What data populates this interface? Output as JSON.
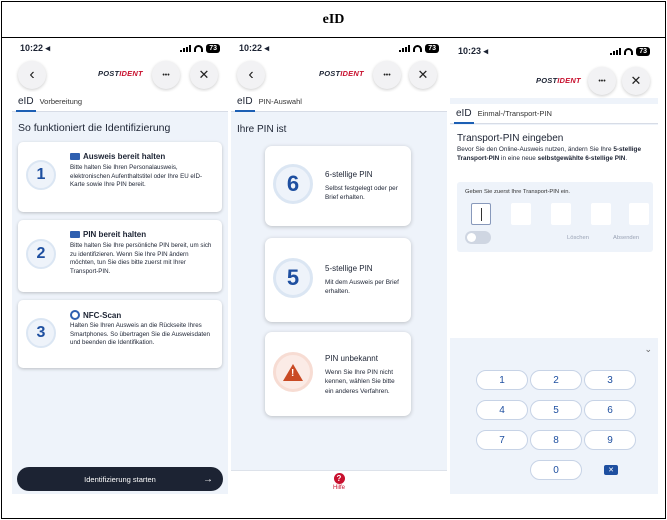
{
  "header": {
    "title": "eID"
  },
  "common": {
    "brand_post": "POST",
    "brand_ident": "IDENT",
    "back_glyph": "‹",
    "more_glyph": "•••",
    "close_glyph": "✕",
    "battery": "73"
  },
  "panel1": {
    "time": "10:22 ◂",
    "tab": "eID",
    "step": "Vorbereitung",
    "title": "So funktioniert die Identifizierung",
    "steps": [
      {
        "num": "1",
        "icon": "id-card-icon",
        "heading": "Ausweis bereit halten",
        "text": "Bitte halten Sie Ihren Personalausweis, elektronischen Aufenthaltstitel oder Ihre EU eID-Karte sowie Ihre PIN bereit."
      },
      {
        "num": "2",
        "icon": "keyboard-icon",
        "heading": "PIN bereit halten",
        "text": "Bitte halten Sie Ihre persönliche PIN bereit, um sich zu identifizieren. Wenn Sie Ihre PIN ändern möchten, tun Sie dies bitte zuerst mit Ihrer Transport-PIN."
      },
      {
        "num": "3",
        "icon": "nfc-icon",
        "heading": "NFC-Scan",
        "text": "Halten Sie Ihren Ausweis an die Rückseite Ihres Smartphones. So übertragen Sie die Ausweisdaten und beenden die Identifikation."
      }
    ],
    "start_button": "Identifizierung starten",
    "start_arrow": "→"
  },
  "panel2": {
    "time": "10:22 ◂",
    "tab": "eID",
    "step": "PIN-Auswahl",
    "title": "Ihre PIN ist",
    "options": [
      {
        "num": "6",
        "title": "6-stellige PIN",
        "text": "Selbst festgelegt oder per Brief erhalten."
      },
      {
        "num": "5",
        "title": "5-stellige PIN",
        "text": "Mit dem Ausweis per Brief erhalten."
      },
      {
        "num": "",
        "title": "PIN unbekannt",
        "text": "Wenn Sie Ihre PIN nicht kennen, wählen Sie bitte ein anderes Verfahren."
      }
    ],
    "help_glyph": "?",
    "help_label": "Hilfe"
  },
  "panel3": {
    "time": "10:23 ◂",
    "tab": "eID",
    "step": "Einmal-/Transport-PIN",
    "title": "Transport-PIN eingeben",
    "desc_1": "Bevor Sie den Online-Ausweis nutzen, ändern Sie Ihre ",
    "desc_bold_1": "5-stellige Transport-PIN",
    "desc_2": " in eine neue ",
    "desc_bold_2": "selbstgewählte 6-stellige PIN",
    "desc_3": ".",
    "pin_hint": "Geben Sie zuerst Ihre Transport-PIN ein.",
    "delete_label": "Löschen",
    "submit_label": "Absenden",
    "chevron": "⌄",
    "keys": [
      "1",
      "2",
      "3",
      "4",
      "5",
      "6",
      "7",
      "8",
      "9",
      "0"
    ],
    "backspace_glyph": "✕"
  }
}
